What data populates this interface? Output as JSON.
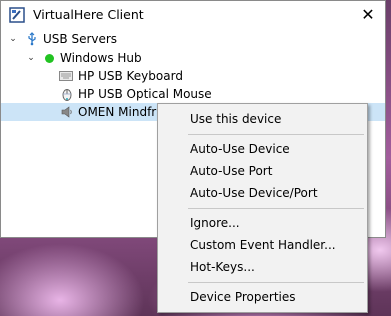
{
  "window": {
    "title": "VirtualHere Client",
    "close_glyph": "✕"
  },
  "tree": {
    "root": {
      "label": "USB Servers",
      "icon": "usb-icon",
      "expanded": true
    },
    "hub": {
      "label": "Windows Hub",
      "status_color": "#22c322",
      "expanded": true
    },
    "devices": [
      {
        "label": "HP USB Keyboard",
        "icon": "keyboard-icon"
      },
      {
        "label": "HP USB Optical Mouse",
        "icon": "mouse-icon"
      },
      {
        "label": "OMEN Mindfra",
        "icon": "speaker-icon",
        "selected": true
      }
    ]
  },
  "context_menu": {
    "items": [
      {
        "label": "Use this device"
      },
      {
        "label": "Auto-Use Device"
      },
      {
        "label": "Auto-Use Port"
      },
      {
        "label": "Auto-Use Device/Port"
      },
      {
        "label": "Ignore..."
      },
      {
        "label": "Custom Event Handler..."
      },
      {
        "label": "Hot-Keys..."
      },
      {
        "label": "Device Properties"
      }
    ]
  },
  "colors": {
    "selection": "#cce4f7",
    "menu_bg": "#f2f2f2"
  }
}
